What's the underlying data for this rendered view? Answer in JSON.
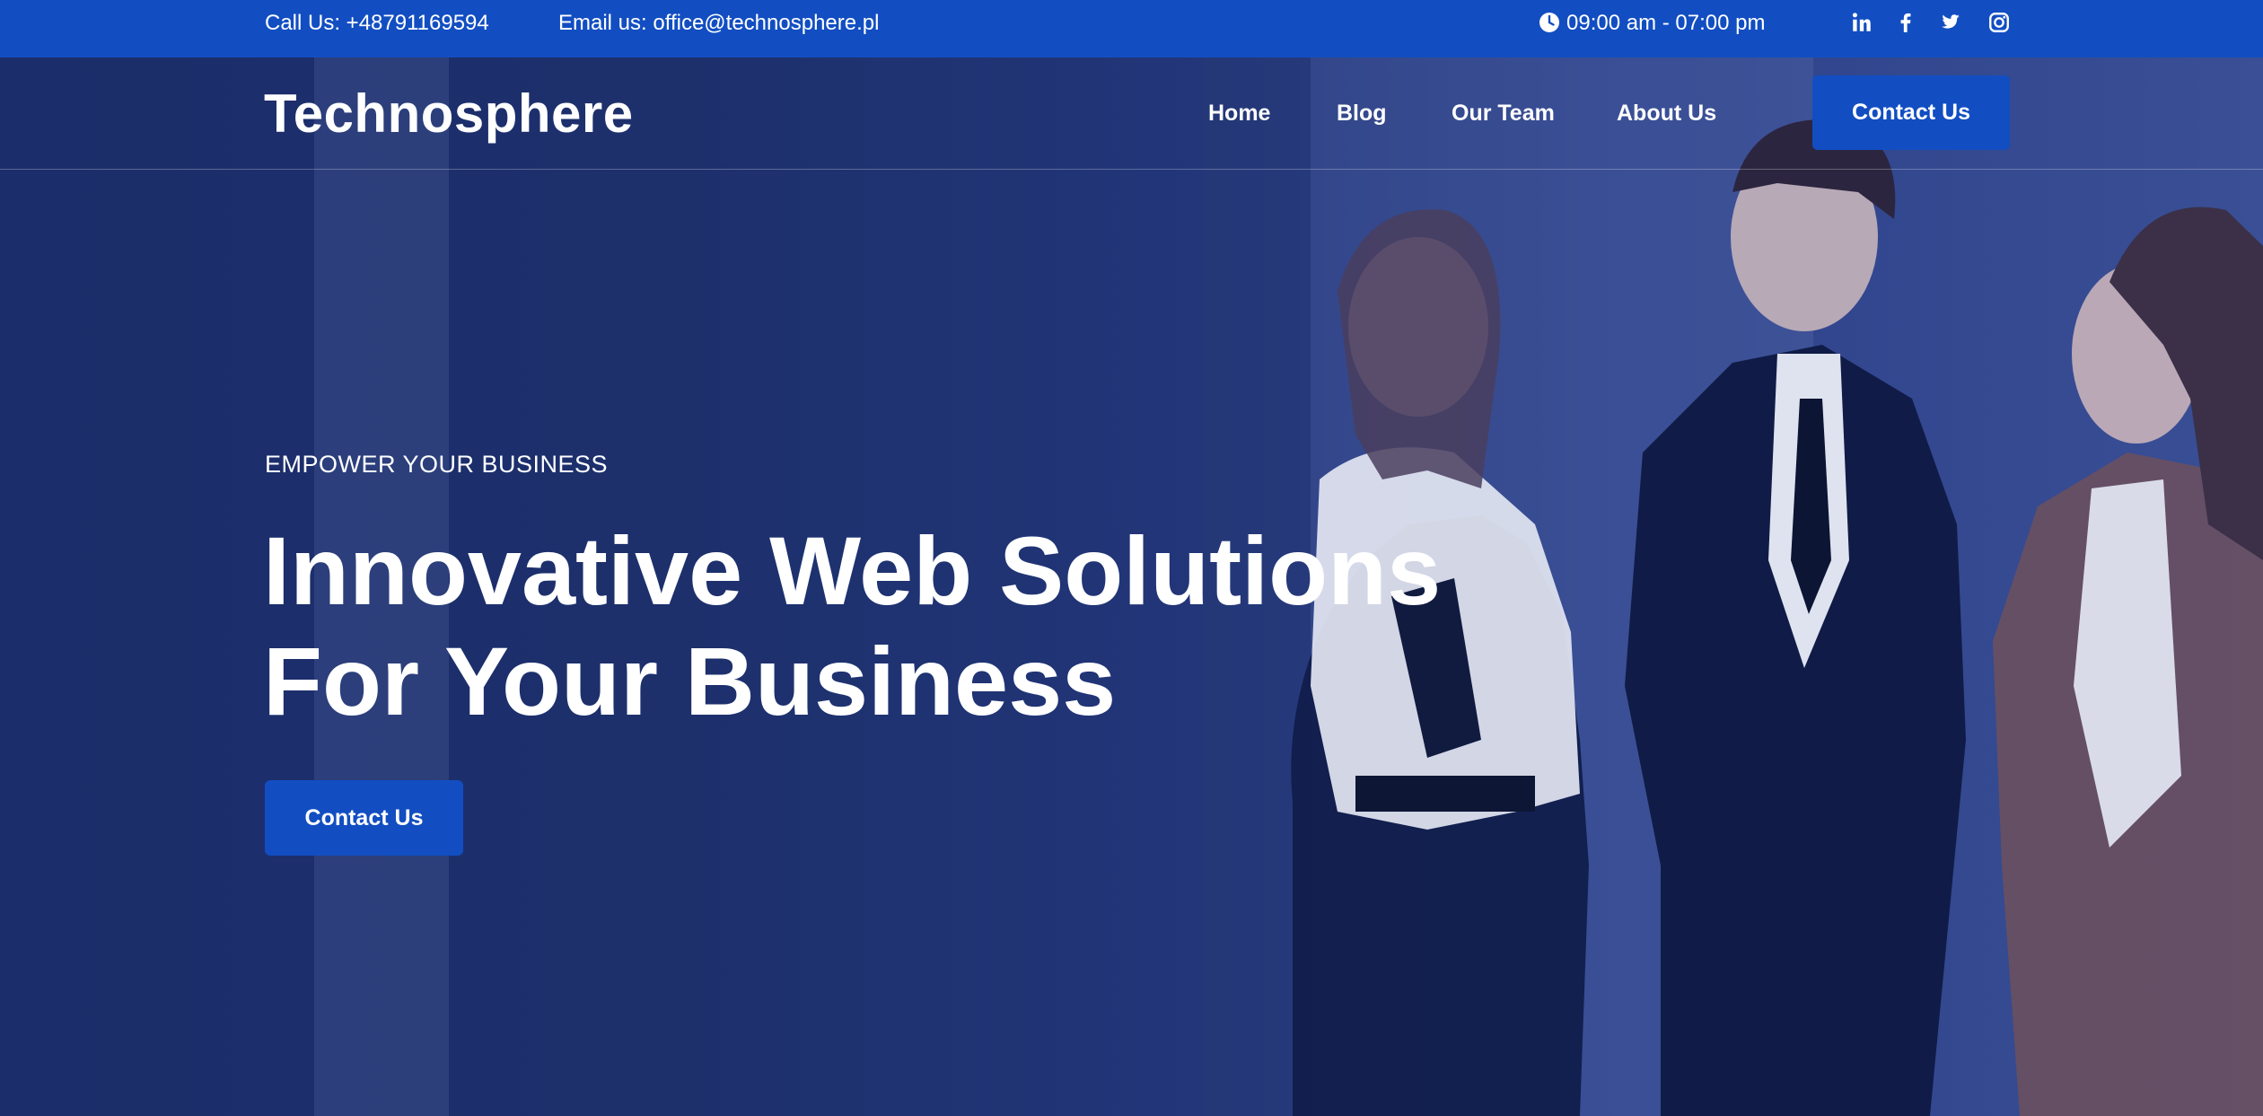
{
  "topbar": {
    "phone": "Call Us: +48791169594",
    "email": "Email us: office@technosphere.pl",
    "hours": "09:00 am - 07:00 pm",
    "icons": [
      "clock-icon",
      "linkedin-icon",
      "facebook-icon",
      "twitter-icon",
      "instagram-icon"
    ]
  },
  "nav": {
    "logo": "Technosphere",
    "links": [
      "Home",
      "Blog",
      "Our Team",
      "About Us"
    ],
    "cta": "Contact Us"
  },
  "hero": {
    "eyebrow": "EMPOWER YOUR BUSINESS",
    "headline_line1": "Innovative Web Solutions",
    "headline_line2": "For Your Business",
    "cta": "Contact Us"
  },
  "colors": {
    "brand_blue": "#124ec2",
    "hero_overlay": "#1b2d6a",
    "text": "#ffffff"
  }
}
